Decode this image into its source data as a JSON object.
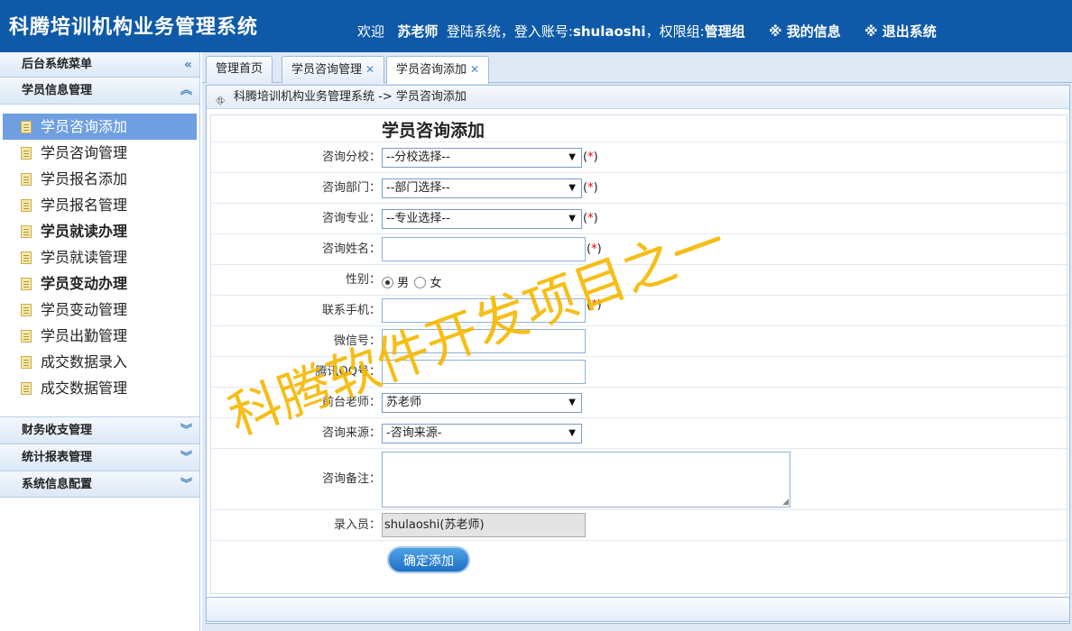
{
  "header": {
    "app_title": "科腾培训机构业务管理系统",
    "welcome_prefix": "欢迎",
    "user_name": "苏老师",
    "login_text": "登陆系统，登入账号:",
    "account": "shulaoshi",
    "group_text": "，权限组:",
    "group": "管理组",
    "my_info": "※ 我的信息",
    "logout": "※ 退出系统",
    "bg_color": "#0f5aa8"
  },
  "sidebar": {
    "menu_title": "后台系统菜单",
    "collapse_icon": "double-chevron-left-icon",
    "section_title": "学员信息管理",
    "items": [
      {
        "label": "学员咨询添加",
        "active": true,
        "bold": false
      },
      {
        "label": "学员咨询管理",
        "active": false,
        "bold": false
      },
      {
        "label": "学员报名添加",
        "active": false,
        "bold": false
      },
      {
        "label": "学员报名管理",
        "active": false,
        "bold": false
      },
      {
        "label": "学员就读办理",
        "active": false,
        "bold": true
      },
      {
        "label": "学员就读管理",
        "active": false,
        "bold": false
      },
      {
        "label": "学员变动办理",
        "active": false,
        "bold": true
      },
      {
        "label": "学员变动管理",
        "active": false,
        "bold": false
      },
      {
        "label": "学员出勤管理",
        "active": false,
        "bold": false
      },
      {
        "label": "成交数据录入",
        "active": false,
        "bold": false
      },
      {
        "label": "成交数据管理",
        "active": false,
        "bold": false
      }
    ],
    "groups": [
      "财务收支管理",
      "统计报表管理",
      "系统信息配置"
    ]
  },
  "tabs": [
    {
      "label": "管理首页",
      "closable": false,
      "active": false
    },
    {
      "label": "学员咨询管理",
      "closable": true,
      "active": false
    },
    {
      "label": "学员咨询添加",
      "closable": true,
      "active": true
    }
  ],
  "breadcrumb": "科腾培训机构业务管理系统 -> 学员咨询添加",
  "form": {
    "title": "学员咨询添加",
    "campus_label": "咨询分校：",
    "campus_value": "--分校选择--",
    "dept_label": "咨询部门：",
    "dept_value": "--部门选择--",
    "major_label": "咨询专业：",
    "major_value": "--专业选择--",
    "name_label": "咨询姓名：",
    "gender_label": "性别：",
    "gender_male": "男",
    "gender_female": "女",
    "phone_label": "联系手机：",
    "wechat_label": "微信号：",
    "qq_label": "腾讯QQ号：",
    "teacher_label": "前台老师：",
    "teacher_value": "苏老师",
    "source_label": "咨询来源：",
    "source_value": "-咨询来源-",
    "remark_label": "咨询备注：",
    "recorder_label": "录入员：",
    "recorder_value": "shulaoshi(苏老师)",
    "submit_label": "确定添加",
    "required_open": "(",
    "required_star": "*",
    "required_close": ")"
  },
  "watermark": "科腾软件开发项目之一"
}
